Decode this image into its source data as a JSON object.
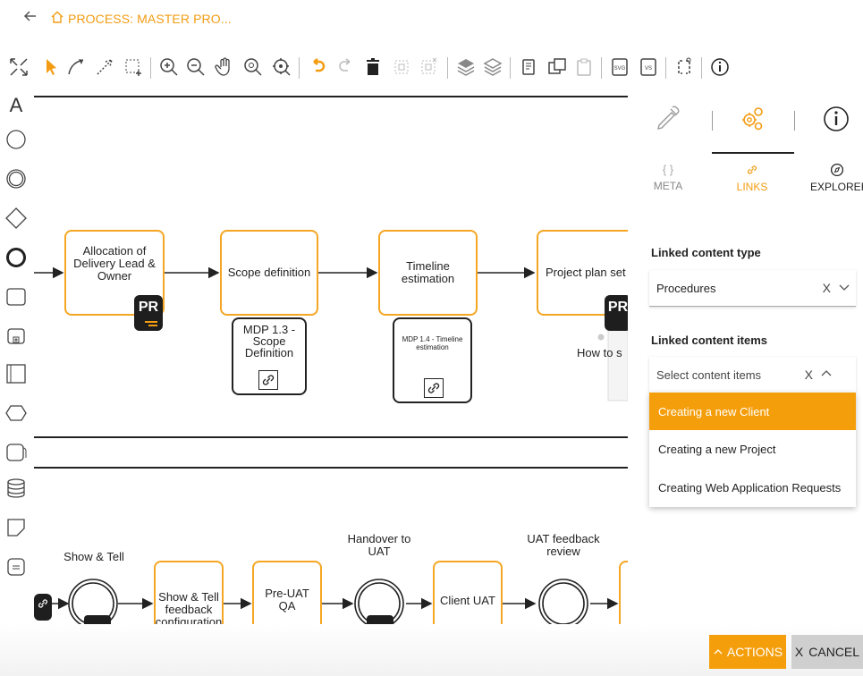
{
  "header": {
    "title": "PROCESS: MASTER PRO..."
  },
  "icons": {
    "back": "arrow-left-icon",
    "home": "home-icon"
  },
  "palette": {
    "text_tool": "A"
  },
  "canvas": {
    "lane1": {
      "tasks": [
        {
          "label": "Allocation of Delivery Lead & Owner"
        },
        {
          "label": "Scope definition"
        },
        {
          "label": "Timeline estimation"
        },
        {
          "label": "Project plan set up"
        }
      ],
      "badge_text": "PR",
      "badge_text_partial": "PR",
      "docs": [
        {
          "label": "MDP 1.3 - Scope Definition"
        },
        {
          "label": "MDP 1.4 - Timeline estimation"
        }
      ],
      "partial_label": "How to s"
    },
    "lane2": {
      "labels": {
        "show_tell": "Show & Tell",
        "handover": "Handover to UAT",
        "uat_review": "UAT feedback review"
      },
      "tasks": [
        {
          "label": "Show & Tell feedback configuration"
        },
        {
          "label": "Pre-UAT QA"
        },
        {
          "label": "Client UAT"
        }
      ]
    }
  },
  "panel": {
    "tabs": [
      {
        "label": "META"
      },
      {
        "label": "LINKS"
      },
      {
        "label": "EXPLORER"
      }
    ],
    "linked_type_label": "Linked content type",
    "linked_type_value": "Procedures",
    "linked_items_label": "Linked content items",
    "linked_items_placeholder": "Select content items",
    "clear_symbol": "X",
    "options": [
      {
        "label": "Creating a new Client"
      },
      {
        "label": "Creating a new Project"
      },
      {
        "label": "Creating Web Application Requests"
      }
    ]
  },
  "footer": {
    "actions_label": "ACTIONS",
    "cancel_label": "CANCEL",
    "cancel_symbol": "X"
  },
  "colors": {
    "accent": "#f39c12",
    "task_border": "#f5a623",
    "selected_option_bg": "#f59e0b",
    "cancel_bg": "#cfcfcf"
  }
}
